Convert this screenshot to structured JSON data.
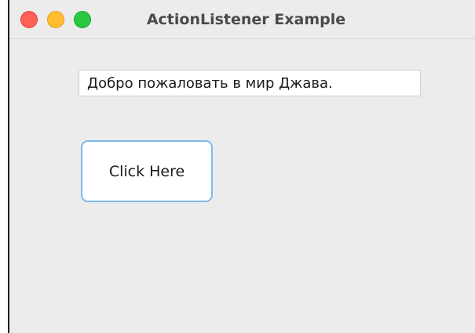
{
  "window": {
    "title": "ActionListener Example"
  },
  "text_field": {
    "value": "Добро пожаловать в мир Джава."
  },
  "button": {
    "label": "Click Here"
  },
  "colors": {
    "close": "#ff5f57",
    "minimize": "#febc2e",
    "zoom": "#28c840",
    "button_focus_border": "#7fb8ec",
    "window_background": "#ececec"
  }
}
